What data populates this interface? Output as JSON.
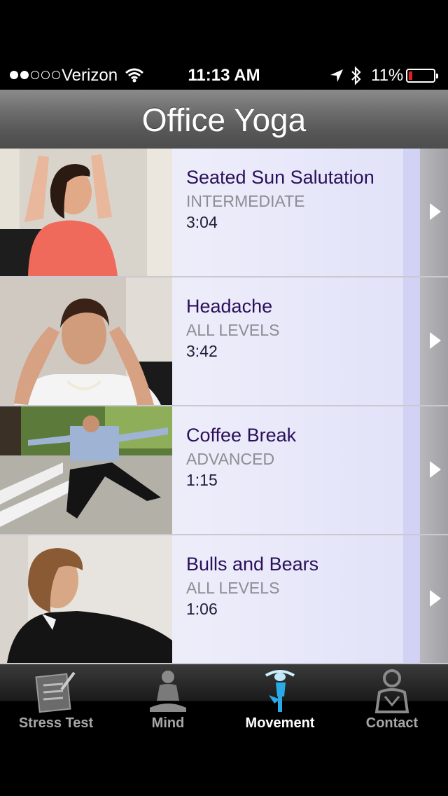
{
  "status_bar": {
    "carrier": "Verizon",
    "time": "11:13 AM",
    "battery": "11%",
    "signal_bars": 2,
    "battery_level": 0.11
  },
  "navbar": {
    "title": "Office Yoga"
  },
  "exercises": [
    {
      "title": "Seated Sun Salutation",
      "level": "INTERMEDIATE",
      "duration": "3:04"
    },
    {
      "title": "Headache",
      "level": "ALL LEVELS",
      "duration": "3:42"
    },
    {
      "title": "Coffee Break",
      "level": "ADVANCED",
      "duration": "1:15"
    },
    {
      "title": "Bulls and Bears",
      "level": "ALL LEVELS",
      "duration": "1:06"
    }
  ],
  "tabs": [
    {
      "label": "Stress Test",
      "icon": "clipboard-checklist-icon"
    },
    {
      "label": "Mind",
      "icon": "meditating-figure-icon"
    },
    {
      "label": "Movement",
      "icon": "yoga-tree-pose-icon",
      "active": true
    },
    {
      "label": "Contact",
      "icon": "person-contact-icon"
    }
  ],
  "colors": {
    "title_text": "#2b0f5a",
    "level_text": "#8d8d93",
    "row_background": "#dcdcf7",
    "active_tab_icon": "#29a9e8"
  }
}
